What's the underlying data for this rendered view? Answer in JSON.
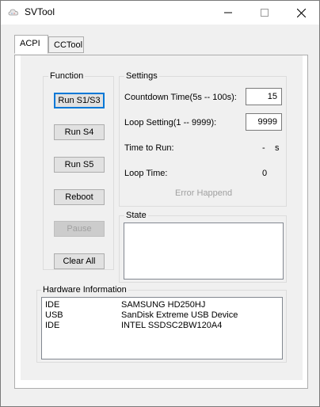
{
  "window": {
    "title": "SVTool",
    "app_icon": "cloud-icon"
  },
  "titlebar_controls": {
    "minimize": "minimize-icon",
    "maximize": "maximize-icon",
    "close": "close-icon"
  },
  "tabs": [
    {
      "label": "ACPI",
      "active": true
    },
    {
      "label": "CCTool",
      "active": false
    }
  ],
  "function_group": {
    "title": "Function",
    "buttons": [
      {
        "label": "Run S1/S3",
        "focused": true,
        "enabled": true
      },
      {
        "label": "Run S4",
        "focused": false,
        "enabled": true
      },
      {
        "label": "Run S5",
        "focused": false,
        "enabled": true
      },
      {
        "label": "Reboot",
        "focused": false,
        "enabled": true
      },
      {
        "label": "Pause",
        "focused": false,
        "enabled": false
      },
      {
        "label": "Clear All",
        "focused": false,
        "enabled": true
      }
    ]
  },
  "settings_group": {
    "title": "Settings",
    "countdown_label": "Countdown Time(5s -- 100s):",
    "countdown_value": "15",
    "loop_setting_label": "Loop Setting(1 -- 9999):",
    "loop_setting_value": "9999",
    "time_to_run_label": "Time to Run:",
    "time_to_run_value": "-",
    "time_to_run_unit": "s",
    "loop_time_label": "Loop Time:",
    "loop_time_value": "0",
    "error_text": "Error Happend"
  },
  "state_group": {
    "title": "State",
    "content": ""
  },
  "hardware_group": {
    "title": "Hardware Information",
    "rows": [
      {
        "type": "IDE",
        "device": "SAMSUNG HD250HJ"
      },
      {
        "type": "USB",
        "device": "SanDisk Extreme USB Device"
      },
      {
        "type": "IDE",
        "device": "INTEL SSDSC2BW120A4"
      }
    ]
  }
}
